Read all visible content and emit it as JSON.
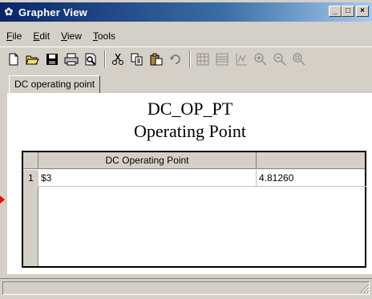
{
  "window": {
    "title": "Grapher View",
    "controls": {
      "minimize": "_",
      "maximize": "□",
      "close": "×"
    }
  },
  "menu": {
    "items": [
      {
        "label_first": "F",
        "label_rest": "ile"
      },
      {
        "label_first": "E",
        "label_rest": "dit"
      },
      {
        "label_first": "V",
        "label_rest": "iew"
      },
      {
        "label_first": "T",
        "label_rest": "ools"
      }
    ]
  },
  "toolbar": {
    "icons": [
      "new-icon",
      "open-icon",
      "save-icon",
      "print-icon",
      "print-preview-icon",
      "cut-icon",
      "copy-icon",
      "paste-icon",
      "undo-icon",
      "grid-icon",
      "table-icon",
      "axis-icon",
      "zoom-in-icon",
      "zoom-out-icon",
      "zoom-fit-icon"
    ]
  },
  "tabs": [
    {
      "label": "DC operating point",
      "active": true
    }
  ],
  "view": {
    "title": "DC_OP_PT",
    "subtitle": "Operating Point",
    "table": {
      "columns": [
        "DC Operating Point",
        ""
      ],
      "rows": [
        {
          "num": "1",
          "name": "$3",
          "value": "4.81260"
        }
      ]
    }
  },
  "status": {
    "text": ""
  },
  "colors": {
    "titlebar_start": "#0a246a",
    "titlebar_end": "#a6caf0",
    "marker": "#ff0000",
    "chrome": "#d4d0c8"
  }
}
